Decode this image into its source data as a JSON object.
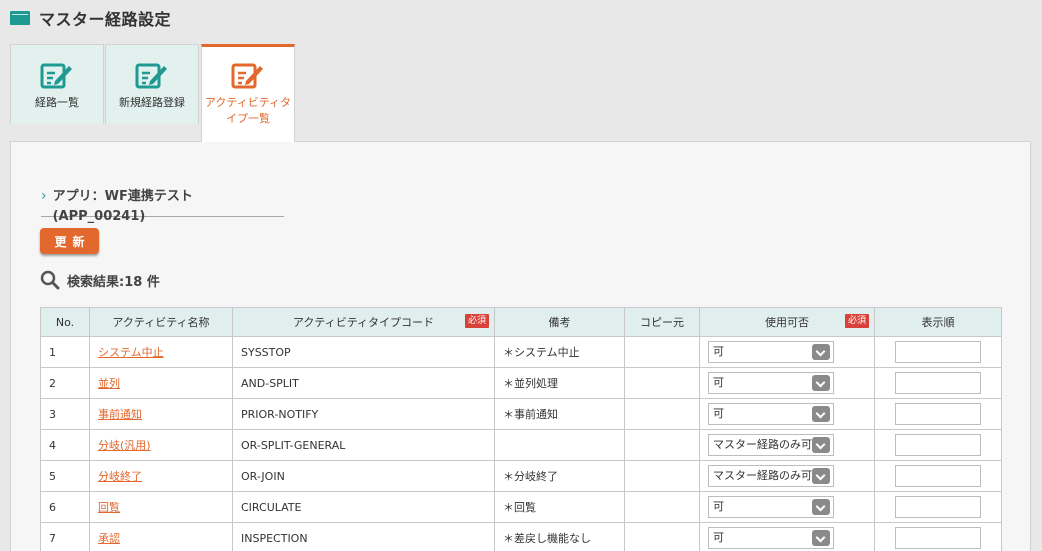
{
  "header": {
    "title": "マスター経路設定"
  },
  "tabs": [
    {
      "label": "経路一覧",
      "active": false,
      "icon": "edit-icon"
    },
    {
      "label": "新規経路登録",
      "active": false,
      "icon": "edit-icon"
    },
    {
      "label": "アクティビティタイプ一覧",
      "active": true,
      "icon": "edit-icon"
    }
  ],
  "app": {
    "label": "アプリ：WF連携テスト(APP_00241)"
  },
  "update_button": "更新",
  "search": {
    "result_label": "検索結果:18 件"
  },
  "table": {
    "required_badge": "必須",
    "columns": [
      "No.",
      "アクティビティ名称",
      "アクティビティタイプコード",
      "備考",
      "コピー元",
      "使用可否",
      "表示順"
    ],
    "rows": [
      {
        "no": "1",
        "name": "システム中止",
        "code": "SYSSTOP",
        "note": "＊システム中止",
        "copy": "",
        "usable": "可",
        "order": ""
      },
      {
        "no": "2",
        "name": "並列",
        "code": "AND-SPLIT",
        "note": "＊並列処理",
        "copy": "",
        "usable": "可",
        "order": ""
      },
      {
        "no": "3",
        "name": "事前通知",
        "code": "PRIOR-NOTIFY",
        "note": "＊事前通知",
        "copy": "",
        "usable": "可",
        "order": ""
      },
      {
        "no": "4",
        "name": "分岐(汎用)",
        "code": "OR-SPLIT-GENERAL",
        "note": "",
        "copy": "",
        "usable": "マスター経路のみ可",
        "order": ""
      },
      {
        "no": "5",
        "name": "分岐終了",
        "code": "OR-JOIN",
        "note": "＊分岐終了",
        "copy": "",
        "usable": "マスター経路のみ可",
        "order": ""
      },
      {
        "no": "6",
        "name": "回覧",
        "code": "CIRCULATE",
        "note": "＊回覧",
        "copy": "",
        "usable": "可",
        "order": ""
      },
      {
        "no": "7",
        "name": "承認",
        "code": "INSPECTION",
        "note": "＊差戻し機能なし",
        "copy": "",
        "usable": "可",
        "order": ""
      }
    ]
  },
  "colors": {
    "accent": "#e2682d",
    "teal": "#1e9a93",
    "header_bg": "#e0efed",
    "required": "#d9423a"
  }
}
